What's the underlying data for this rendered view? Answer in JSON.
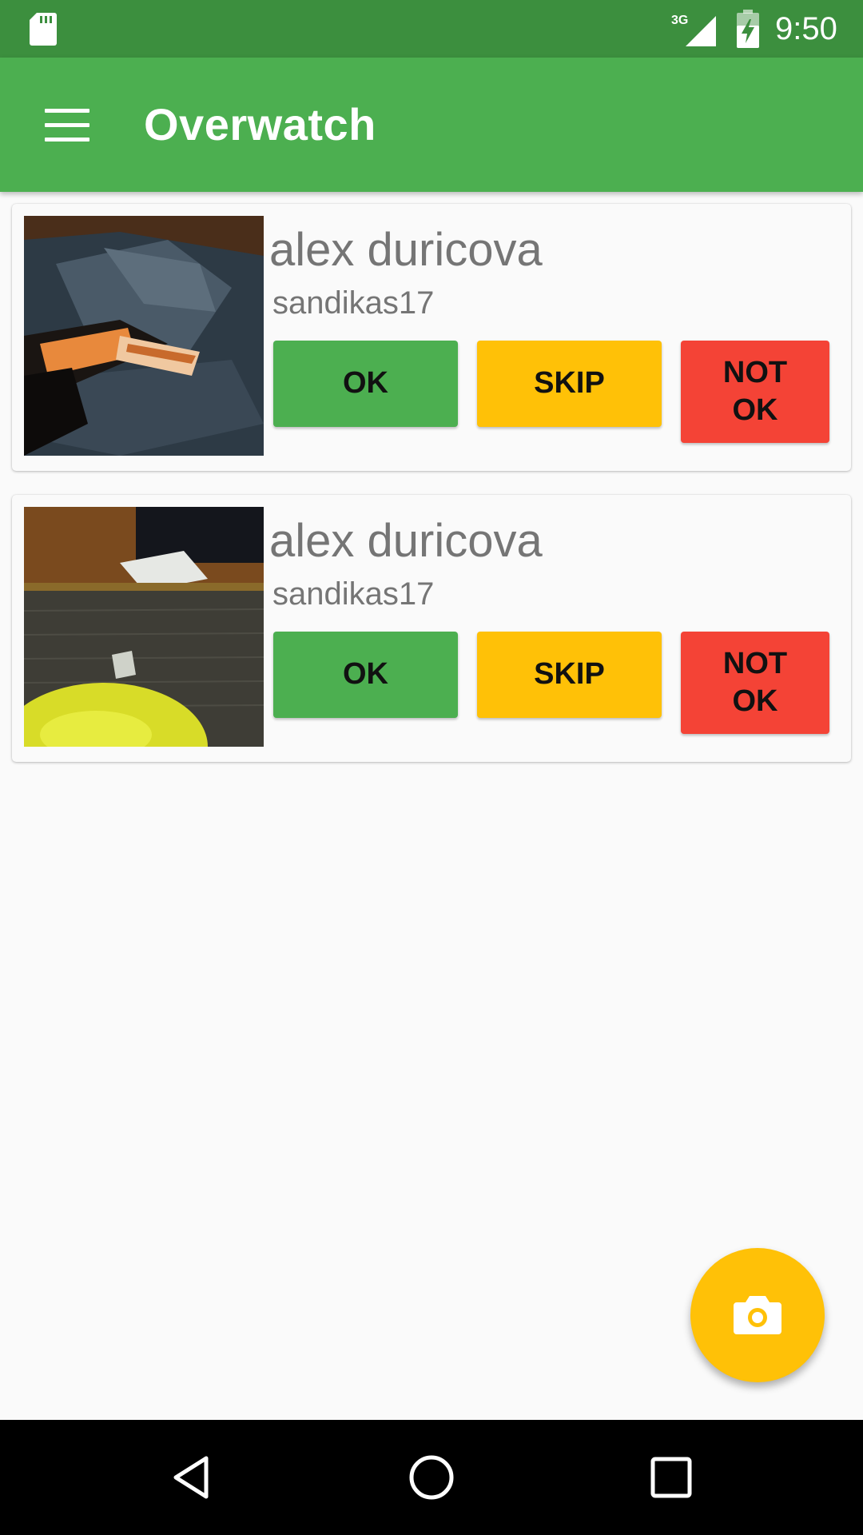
{
  "status_bar": {
    "time": "9:50",
    "network_type": "3G",
    "icons": [
      "sd-card-icon",
      "cell-signal-icon",
      "battery-charging-icon"
    ]
  },
  "app_bar": {
    "title": "Overwatch",
    "menu_icon": "hamburger-menu-icon"
  },
  "cards": [
    {
      "name": "alex duricova",
      "username": "sandikas17",
      "buttons": {
        "ok": "OK",
        "skip": "SKIP",
        "not_ok_line1": "NOT",
        "not_ok_line2": "OK"
      }
    },
    {
      "name": "alex duricova",
      "username": "sandikas17",
      "buttons": {
        "ok": "OK",
        "skip": "SKIP",
        "not_ok_line1": "NOT",
        "not_ok_line2": "OK"
      }
    }
  ],
  "fab": {
    "icon": "camera-icon"
  },
  "nav_bar": {
    "icons": [
      "back-icon",
      "home-icon",
      "recents-icon"
    ]
  },
  "colors": {
    "status_bar": "#3c8f3e",
    "app_bar": "#4caf50",
    "ok": "#4caf50",
    "skip": "#ffc107",
    "not_ok": "#f44336",
    "fab": "#ffc107",
    "text_secondary": "#757575"
  }
}
